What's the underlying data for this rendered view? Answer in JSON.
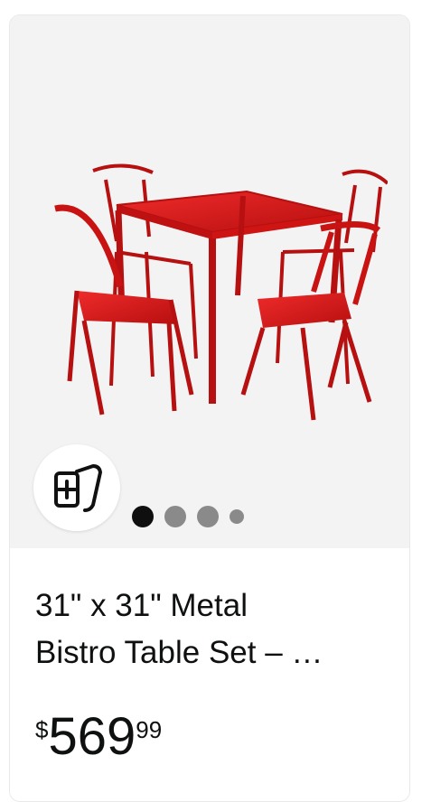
{
  "product": {
    "title": "31\" x 31\" Metal\nBistro Table Set – …",
    "price": {
      "symbol": "$",
      "whole": "569",
      "fraction": "99"
    },
    "image_color": "#d61616"
  },
  "carousel": {
    "active_index": 0,
    "dots": [
      "active",
      "inactive",
      "inactive",
      "small"
    ]
  },
  "icons": {
    "compare": "compare-cards-plus-icon"
  }
}
